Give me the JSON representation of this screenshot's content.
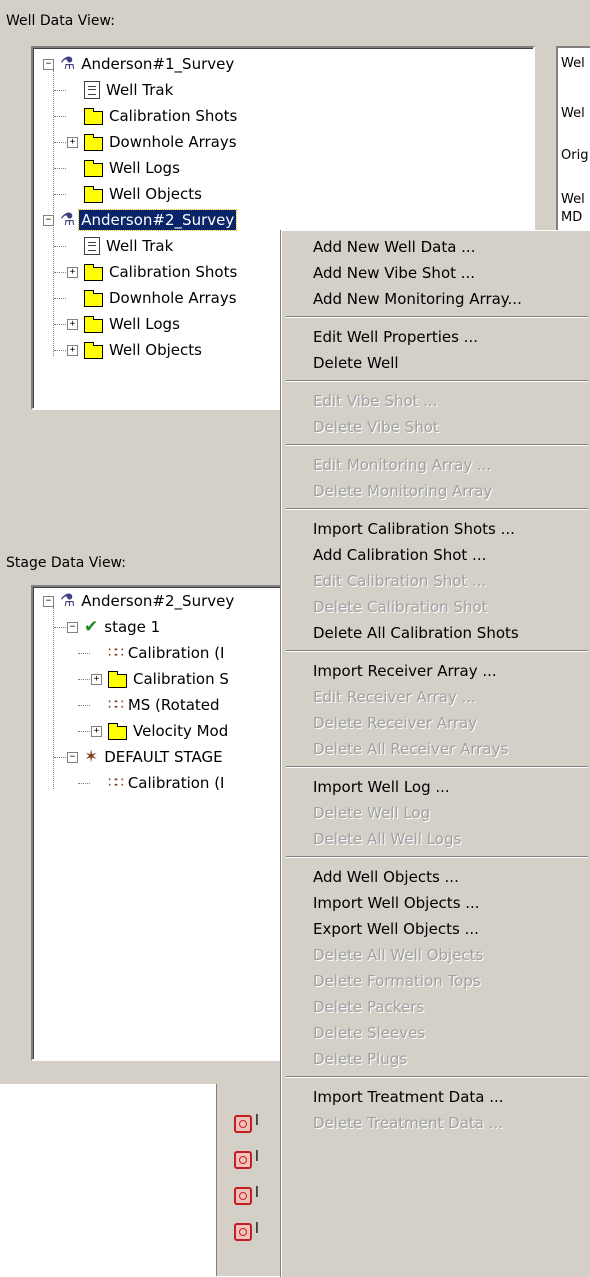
{
  "well_view": {
    "label": "Well Data View:",
    "tree": [
      {
        "label": "Anderson#1_Survey",
        "icon": "rig-icon",
        "expander": "−"
      },
      {
        "label": "Well Trak",
        "icon": "document-icon",
        "expander": ""
      },
      {
        "label": "Calibration Shots",
        "icon": "folder-icon",
        "expander": ""
      },
      {
        "label": "Downhole Arrays",
        "icon": "folder-icon",
        "expander": "+"
      },
      {
        "label": "Well Logs",
        "icon": "folder-icon",
        "expander": ""
      },
      {
        "label": "Well Objects",
        "icon": "folder-icon",
        "expander": ""
      },
      {
        "label": "Anderson#2_Survey",
        "icon": "rig-icon",
        "expander": "−",
        "selected": true
      },
      {
        "label": "Well Trak",
        "icon": "document-icon",
        "expander": ""
      },
      {
        "label": "Calibration Shots",
        "icon": "folder-icon",
        "expander": "+"
      },
      {
        "label": "Downhole Arrays",
        "icon": "folder-icon",
        "expander": ""
      },
      {
        "label": "Well Logs",
        "icon": "folder-icon",
        "expander": "+"
      },
      {
        "label": "Well Objects",
        "icon": "folder-icon",
        "expander": "+"
      }
    ]
  },
  "properties_panel": {
    "labels": [
      "Wel",
      "Wel",
      "Orig",
      "Wel",
      "MD"
    ]
  },
  "stage_view": {
    "label": "Stage Data View:",
    "tree": [
      {
        "label": "Anderson#2_Survey",
        "icon": "rig-icon",
        "expander": "−"
      },
      {
        "label": "stage 1",
        "icon": "checked-stage-icon",
        "expander": "−"
      },
      {
        "label": "Calibration (I",
        "icon": "array-icon",
        "expander": ""
      },
      {
        "label": "Calibration S",
        "icon": "folder-icon",
        "expander": "+"
      },
      {
        "label": "MS (Rotated",
        "icon": "array-icon",
        "expander": ""
      },
      {
        "label": "Velocity Mod",
        "icon": "folder-icon",
        "expander": "+"
      },
      {
        "label": "DEFAULT STAGE",
        "icon": "stage-icon",
        "expander": "−"
      },
      {
        "label": "Calibration (I",
        "icon": "array-icon",
        "expander": ""
      }
    ]
  },
  "context_menu": {
    "groups": [
      [
        {
          "label": "Add New Well Data ...",
          "enabled": true
        },
        {
          "label": "Add New Vibe Shot ...",
          "enabled": true
        },
        {
          "label": "Add New Monitoring Array...",
          "enabled": true
        }
      ],
      [
        {
          "label": "Edit Well Properties ...",
          "enabled": true
        },
        {
          "label": "Delete Well",
          "enabled": true
        }
      ],
      [
        {
          "label": "Edit Vibe Shot ...",
          "enabled": false
        },
        {
          "label": "Delete Vibe Shot",
          "enabled": false
        }
      ],
      [
        {
          "label": "Edit Monitoring Array ...",
          "enabled": false
        },
        {
          "label": "Delete Monitoring Array",
          "enabled": false
        }
      ],
      [
        {
          "label": "Import Calibration Shots ...",
          "enabled": true
        },
        {
          "label": "Add Calibration Shot ...",
          "enabled": true
        },
        {
          "label": "Edit Calibration Shot ...",
          "enabled": false
        },
        {
          "label": "Delete Calibration Shot",
          "enabled": false
        },
        {
          "label": "Delete All Calibration Shots",
          "enabled": true
        }
      ],
      [
        {
          "label": "Import Receiver Array ...",
          "enabled": true
        },
        {
          "label": "Edit Receiver Array ...",
          "enabled": false
        },
        {
          "label": "Delete Receiver Array",
          "enabled": false
        },
        {
          "label": "Delete All Receiver Arrays",
          "enabled": false
        }
      ],
      [
        {
          "label": "Import Well Log ...",
          "enabled": true
        },
        {
          "label": "Delete Well Log",
          "enabled": false
        },
        {
          "label": "Delete All Well Logs",
          "enabled": false
        }
      ],
      [
        {
          "label": "Add Well Objects ...",
          "enabled": true
        },
        {
          "label": "Import Well Objects ...",
          "enabled": true
        },
        {
          "label": "Export Well Objects ...",
          "enabled": true
        },
        {
          "label": "Delete All Well Objects",
          "enabled": false
        },
        {
          "label": "Delete Formation Tops",
          "enabled": false
        },
        {
          "label": "Delete Packers",
          "enabled": false
        },
        {
          "label": "Delete Sleeves",
          "enabled": false
        },
        {
          "label": "Delete Plugs",
          "enabled": false
        }
      ],
      [
        {
          "label": "Import Treatment Data ...",
          "enabled": true
        },
        {
          "label": "Delete Treatment Data ...",
          "enabled": false
        }
      ]
    ]
  },
  "background_list": {
    "items": [
      "l",
      "l",
      "l",
      "l"
    ]
  }
}
